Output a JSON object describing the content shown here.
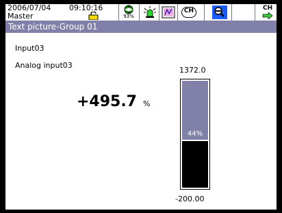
{
  "status_bar": {
    "date": "2006/07/04",
    "time": "09:10:16",
    "user": "Master",
    "memory_percent": "93%",
    "icons": [
      "lock-icon",
      "memory-icon",
      "alarm-icon",
      "report-icon",
      "ch-icon",
      "search-icon",
      "channel-switch-icon"
    ],
    "ch_icon_label": "CH",
    "channel_switch_label": "CH"
  },
  "title": "Text picture-Group 01",
  "channel": {
    "tag": "Input03",
    "comment": "Analog input03",
    "value": "+495.7",
    "unit": "%",
    "scale_max": "1372.0",
    "scale_min": "-200.00",
    "bar_percent_label": "44%",
    "bar_fraction": 0.44
  },
  "colors": {
    "title_bg": "#8080a8",
    "bar_empty": "#8080a8",
    "bar_fill": "#000000",
    "search_bg": "#1a5cff"
  }
}
